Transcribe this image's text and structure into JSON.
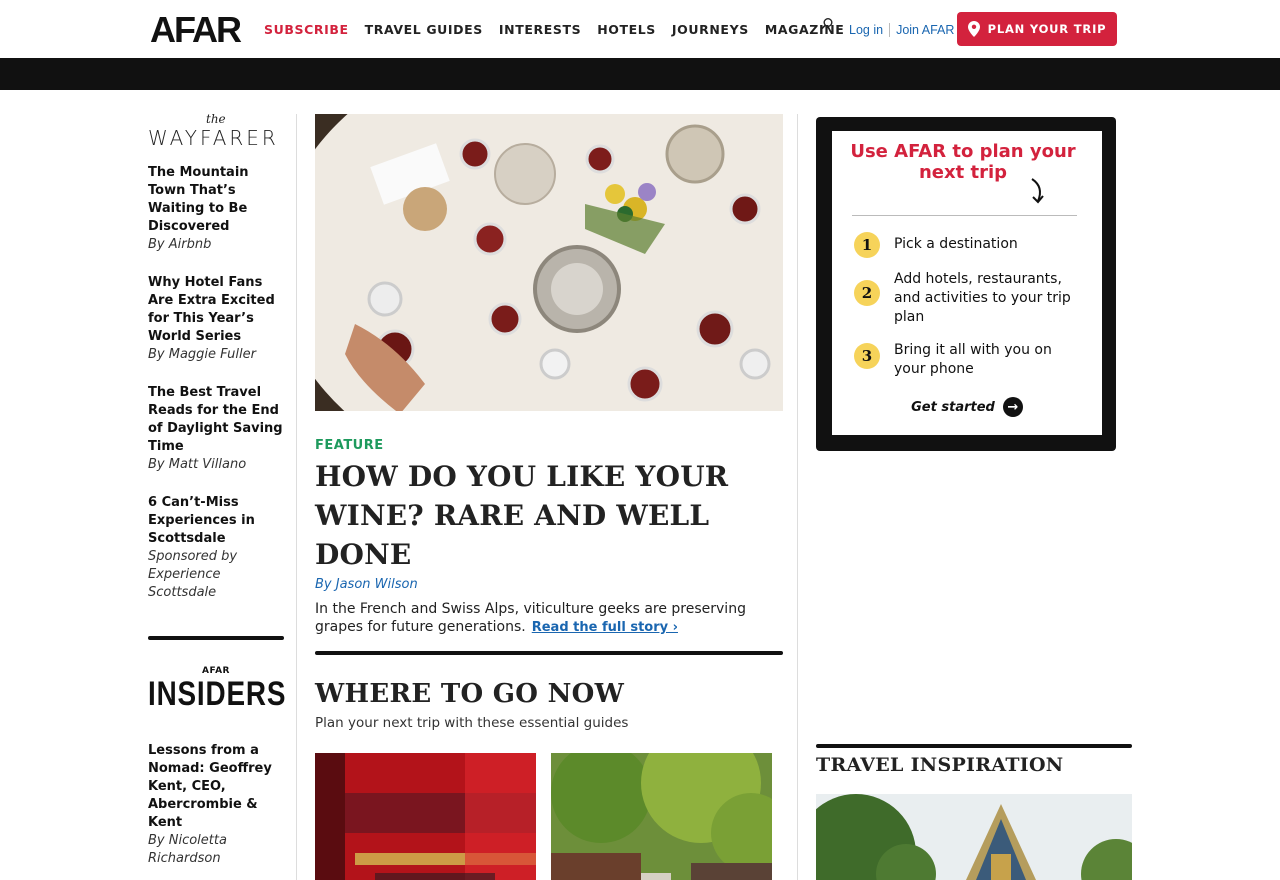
{
  "header": {
    "logo": "AFAR",
    "nav": [
      "SUBSCRIBE",
      "TRAVEL GUIDES",
      "INTERESTS",
      "HOTELS",
      "JOURNEYS",
      "MAGAZINE"
    ],
    "login": "Log in",
    "join": "Join AFAR",
    "plan_button": "PLAN YOUR TRIP",
    "accent": "#d3223d"
  },
  "left": {
    "wayfarer_the": "the",
    "wayfarer_word": "WAYFARER",
    "stories": [
      {
        "title": "The Mountain Town That’s Waiting to Be Discovered",
        "by": "By Airbnb"
      },
      {
        "title": "Why Hotel Fans Are Extra Excited for This Year’s World Series",
        "by": "By Maggie Fuller"
      },
      {
        "title": "The Best Travel Reads for the End of Daylight Saving Time",
        "by": "By Matt Villano"
      },
      {
        "title": "6 Can’t-Miss Experiences in Scottsdale",
        "by": "Sponsored by Experience Scottsdale"
      }
    ],
    "insiders_small": "AFAR",
    "insiders_big": "INSIDERS",
    "insider_story": {
      "title": "Lessons from a Nomad: Geoffrey Kent, CEO, Abercrombie & Kent",
      "by": "By Nicoletta Richardson"
    }
  },
  "feature": {
    "kicker": "FEATURE",
    "headline": "HOW DO YOU LIKE YOUR WINE? RARE AND WELL DONE",
    "byline": "By Jason Wilson",
    "dek": "In the French and Swiss Alps, viticulture geeks are preserving grapes for future generations.",
    "read_more": "Read the full story ›",
    "kicker_color": "#1e9a5d"
  },
  "where_to_go": {
    "title": "WHERE TO GO NOW",
    "subtitle": "Plan your next trip with these essential guides"
  },
  "ad": {
    "title": "Use AFAR to plan your next trip",
    "steps": [
      {
        "num": "1",
        "text": "Pick a destination"
      },
      {
        "num": "2",
        "text": "Add hotels, restaurants, and activities to your trip plan"
      },
      {
        "num": "3",
        "text": "Bring it all with you on your phone"
      }
    ],
    "cta": "Get started"
  },
  "travel_inspiration": {
    "title": "TRAVEL INSPIRATION"
  }
}
